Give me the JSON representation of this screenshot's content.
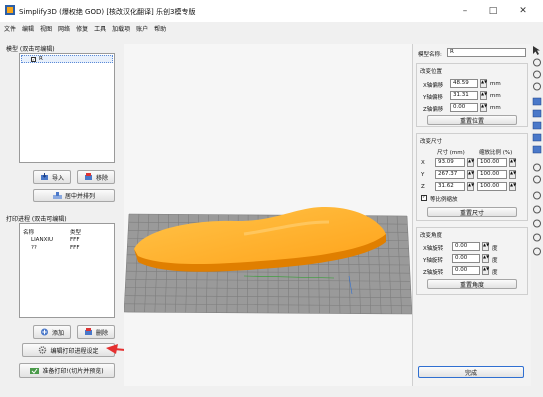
{
  "window": {
    "title": "Simplify3D (爆权绝 GOD) [核改汉化翻译] 乐创3模专版",
    "minimize": "–",
    "maximize": "□",
    "close": "✕"
  },
  "menu": [
    "文件",
    "编辑",
    "视图",
    "网络",
    "修复",
    "工具",
    "加载项",
    "账户",
    "帮助"
  ],
  "models_panel": {
    "label": "模型 (双击可编辑)",
    "items": [
      {
        "name": "R",
        "checked": true
      }
    ],
    "import_label": "导入",
    "remove_label": "移除",
    "center_label": "居中并排列"
  },
  "processes_panel": {
    "label": "打印进程 (双击可编辑)",
    "col_name": "名称",
    "col_type": "类型",
    "rows": [
      {
        "name": "LIANXIU",
        "type": "FFF"
      },
      {
        "name": "??",
        "type": "FFF"
      }
    ],
    "add_label": "添加",
    "delete_label": "删除",
    "edit_settings_label": "编辑打印进程设定",
    "prepare_label": "准备打印!(切片并预览)"
  },
  "props": {
    "name_label": "模型名称:",
    "name_value": "R",
    "position": {
      "title": "改变位置",
      "x_label": "X轴偏移",
      "x_value": "48.59",
      "y_label": "Y轴偏移",
      "y_value": "31.31",
      "z_label": "Z轴偏移",
      "z_value": "0.00",
      "unit": "mm",
      "reset_label": "重置位置"
    },
    "size": {
      "title": "改变尺寸",
      "size_header": "尺寸 (mm)",
      "scale_header": "缩放比例 (%)",
      "x_label": "X",
      "x_size": "93.09",
      "x_scale": "100.00",
      "y_label": "Y",
      "y_size": "267.37",
      "y_scale": "100.00",
      "z_label": "Z",
      "z_size": "31.62",
      "z_scale": "100.00",
      "uniform_label": "等比例缩放",
      "uniform_checked": true,
      "reset_label": "重置尺寸"
    },
    "rotation": {
      "title": "改变角度",
      "x_label": "X轴旋转",
      "x_value": "0.00",
      "y_label": "Y轴旋转",
      "y_value": "0.00",
      "z_label": "Z轴旋转",
      "z_value": "0.00",
      "unit": "度",
      "reset_label": "重置角度"
    },
    "done_label": "完成"
  },
  "colors": {
    "model": "#ffb020",
    "model_dark": "#e07f00",
    "bed": "#9a9a9a",
    "bed_grid": "#7a7a7a",
    "annotation_arrow": "#e53030",
    "accent": "#2f6fd1"
  },
  "toolbar_icons": [
    "cursor-icon",
    "move-icon",
    "resize-icon",
    "rotate-icon",
    "view-default-icon",
    "view-top-icon",
    "view-front-icon",
    "view-side-icon",
    "view-iso-icon",
    "ruler-icon",
    "cube-icon",
    "camera-icon",
    "axis-icon",
    "mesh-icon",
    "settings-icon",
    "grid-icon"
  ]
}
